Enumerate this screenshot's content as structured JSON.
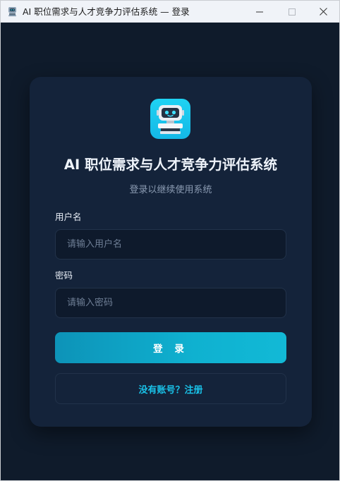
{
  "window": {
    "title": "AI 职位需求与人才竞争力评估系统 — 登录",
    "app_icon": "robot-icon",
    "controls": [
      "minimize-icon",
      "maximize-icon",
      "close-icon"
    ]
  },
  "login": {
    "logo_icon": "robot-icon",
    "title": "AI 职位需求与人才竞争力评估系统",
    "subtitle": "登录以继续使用系统",
    "username": {
      "label": "用户名",
      "placeholder": "请输入用户名",
      "value": ""
    },
    "password": {
      "label": "密码",
      "placeholder": "请输入密码",
      "value": ""
    },
    "login_button": "登 录",
    "register_link": "没有账号？注册"
  },
  "colors": {
    "background": "#0f1b2b",
    "card": "#14233a",
    "accent": "#0fb1d0",
    "link": "#19c2e8"
  }
}
